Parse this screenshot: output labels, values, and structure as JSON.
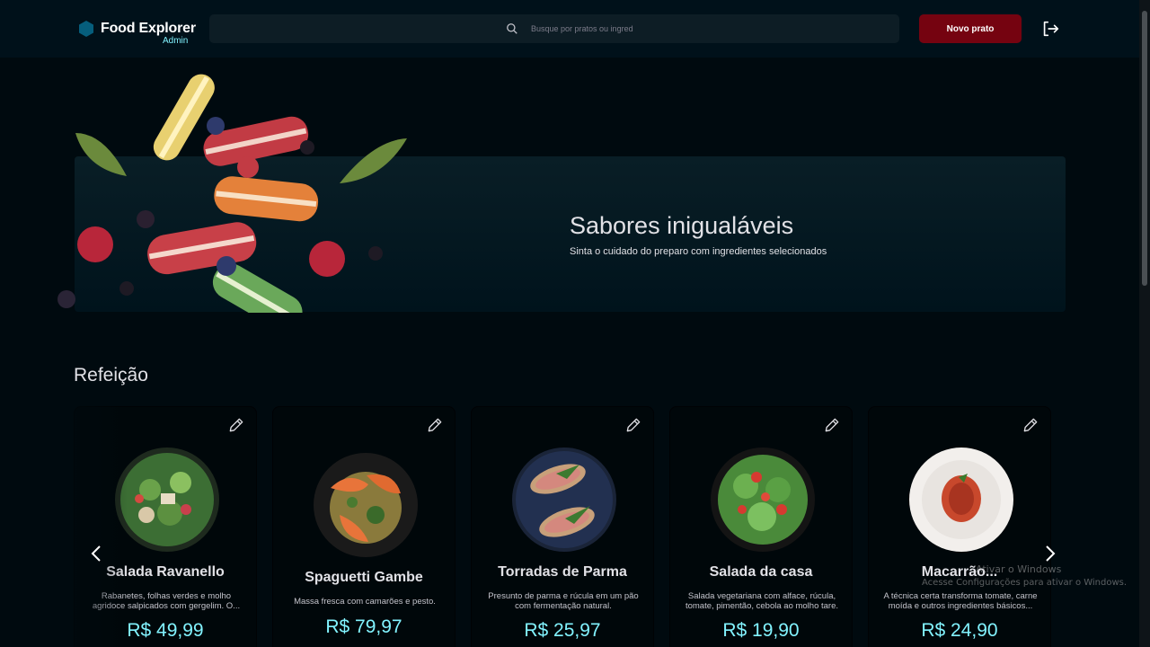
{
  "header": {
    "app_name": "Food Explorer",
    "role_badge": "Admin",
    "search_placeholder": "Busque por pratos ou ingred",
    "new_dish_label": "Novo prato"
  },
  "banner": {
    "title": "Sabores inigualáveis",
    "subtitle": "Sinta o cuidado do preparo com ingredientes selecionados"
  },
  "section": {
    "title": "Refeição"
  },
  "dishes": [
    {
      "name": "Salada Ravanello",
      "description": "Rabanetes, folhas verdes e molho agridoce salpicados com gergelim. O...",
      "price": "R$ 49,99"
    },
    {
      "name": "Spaguetti Gambe",
      "description": "Massa fresca com camarões e pesto.",
      "price": "R$ 79,97"
    },
    {
      "name": "Torradas de Parma",
      "description": "Presunto de parma e rúcula em um pão com fermentação natural.",
      "price": "R$ 25,97"
    },
    {
      "name": "Salada da casa",
      "description": "Salada vegetariana com alface, rúcula, tomate, pimentão, cebola ao molho tare.",
      "price": "R$ 19,90"
    },
    {
      "name": "Macarrão...",
      "description": "A técnica certa transforma tomate, carne moída e outros ingredientes básicos...",
      "price": "R$ 24,90"
    }
  ],
  "watermark": {
    "line1": "Ativar o Windows",
    "line2": "Acesse Configurações para ativar o Windows."
  },
  "colors": {
    "background": "#000a0f",
    "header": "#00111a",
    "accent": "#82f3ff",
    "button": "#750310"
  }
}
